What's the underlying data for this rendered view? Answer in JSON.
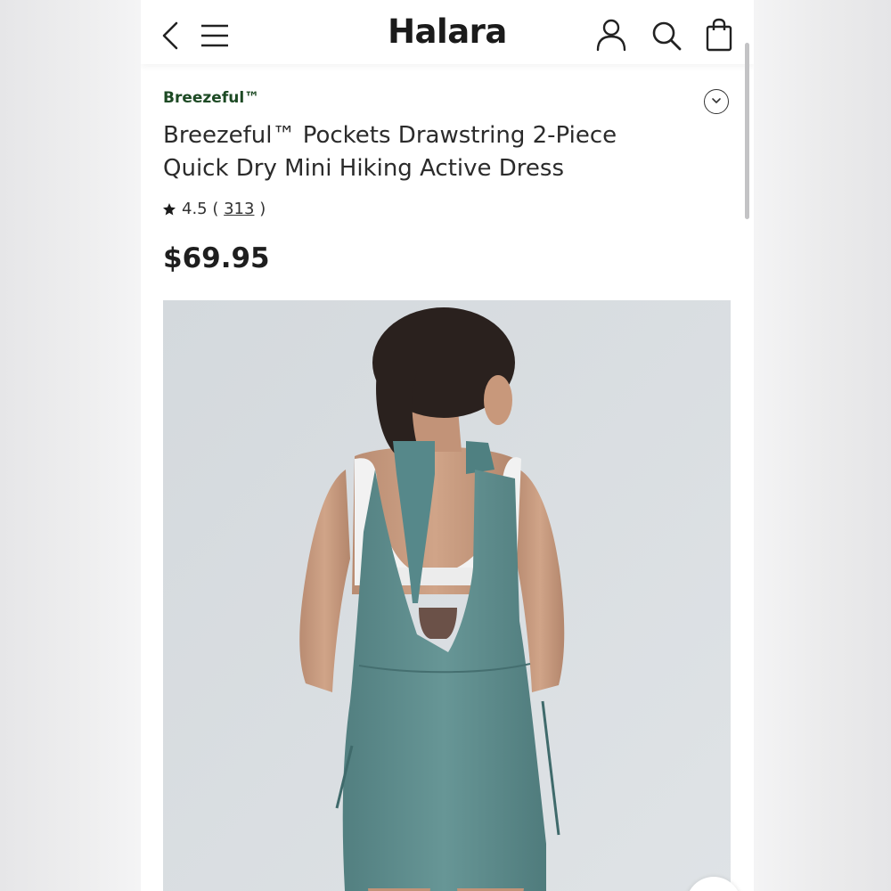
{
  "header": {
    "logo": "Halara",
    "icons": [
      "back-icon",
      "menu-icon",
      "account-icon",
      "search-icon",
      "bag-icon"
    ]
  },
  "product": {
    "brand": "Breezeful™",
    "title": "Breezeful™ Pockets Drawstring 2-Piece Quick Dry Mini Hiking Active Dress",
    "rating": "4.5",
    "rating_open": " ( ",
    "review_count": "313",
    "rating_close": " )",
    "price": "$69.95"
  },
  "image": {
    "alt": "Back view of model wearing teal open-back mini hiking dress over white sports bra"
  },
  "colors": {
    "brand_green": "#1d4a24",
    "dress_teal": "#5e8e8e",
    "image_bg": "#d8dde1"
  }
}
